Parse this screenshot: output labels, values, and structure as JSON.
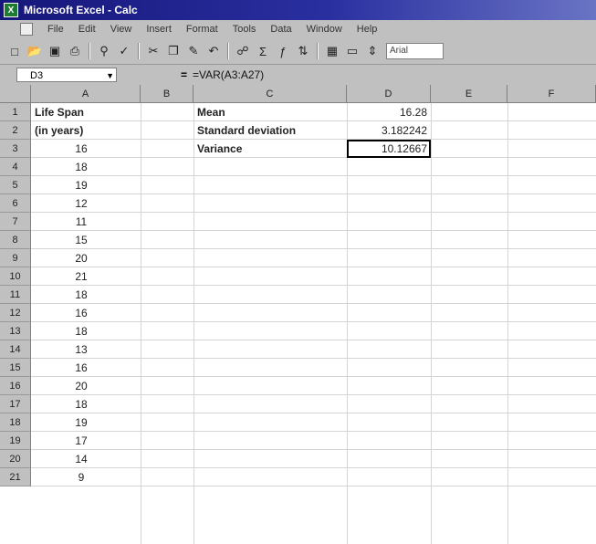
{
  "app": {
    "title": "Microsoft Excel - Calc"
  },
  "menu": [
    "File",
    "Edit",
    "View",
    "Insert",
    "Format",
    "Tools",
    "Data",
    "Window",
    "Help"
  ],
  "toolbar": {
    "font_name": "Arial",
    "icons": [
      "new-icon",
      "open-icon",
      "save-icon",
      "print-icon",
      "print-preview-icon",
      "spelling-icon",
      "cut-icon",
      "copy-icon",
      "paste-icon",
      "undo-icon",
      "hyperlink-icon",
      "autosum-icon",
      "function-icon",
      "sort-ascending-icon",
      "chart-wizard-icon",
      "drawing-icon",
      "zoom-icon"
    ]
  },
  "formula_bar": {
    "name_box": "D3",
    "equals": "=",
    "formula": "=VAR(A3:A27)"
  },
  "columns": [
    "A",
    "B",
    "C",
    "D",
    "E",
    "F"
  ],
  "rows": [
    "1",
    "2",
    "3",
    "4",
    "5",
    "6",
    "7",
    "8",
    "9",
    "10",
    "11",
    "12",
    "13",
    "14",
    "15",
    "16",
    "17",
    "18",
    "19",
    "20",
    "21"
  ],
  "cells": {
    "A1": "Life Span",
    "A2": "(in years)",
    "C1": "Mean",
    "C2": "Standard deviation",
    "C3": "Variance",
    "D1": "16.28",
    "D2": "3.182242",
    "D3": "10.12667"
  },
  "life_spans": [
    "16",
    "18",
    "19",
    "12",
    "11",
    "15",
    "20",
    "21",
    "18",
    "16",
    "18",
    "13",
    "16",
    "20",
    "18",
    "19",
    "17",
    "14",
    "9"
  ],
  "selection": "D3"
}
